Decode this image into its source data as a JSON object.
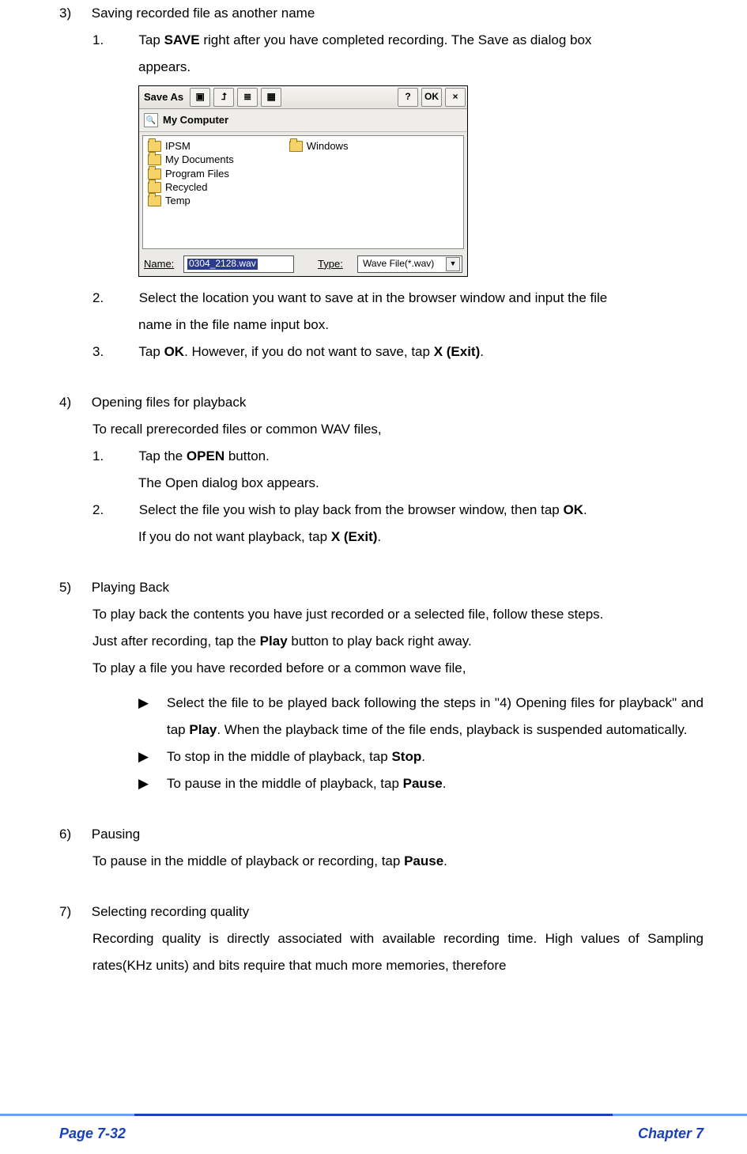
{
  "s3": {
    "num": "3)",
    "title": "Saving recorded file as another name",
    "step1_num": "1.",
    "step1a": "Tap ",
    "step1b": "SAVE",
    "step1c": " right after you have completed recording. The Save as dialog box",
    "step1d": "appears.",
    "step2_num": "2.",
    "step2a": "Select the location you want to save at in the browser window and input the file",
    "step2b": "name in the file name input box.",
    "step3_num": "3.",
    "step3a": "Tap ",
    "step3b": "OK",
    "step3c": ". However, if you do not want to save, tap ",
    "step3d": "X (Exit)",
    "step3e": "."
  },
  "dialog": {
    "title": "Save As",
    "btn_help": "?",
    "btn_ok": "OK",
    "btn_close": "×",
    "loc": "My Computer",
    "foldersA": [
      "IPSM",
      "My Documents",
      "Program Files",
      "Recycled",
      "Temp"
    ],
    "foldersB": [
      "Windows"
    ],
    "name_u": "N",
    "name_rest": "ame:",
    "name_val": "0304_2128.wav",
    "type_u": "T",
    "type_rest": "ype:",
    "type_val": "Wave File(*.wav)"
  },
  "s4": {
    "num": "4)",
    "title": "Opening files for playback",
    "intro": "To recall prerecorded files or common WAV files,",
    "step1_num": "1.",
    "step1a": "Tap the ",
    "step1b": "OPEN",
    "step1c": " button.",
    "step1d": "The Open dialog box appears.",
    "step2_num": "2.",
    "step2a": "Select the file you wish to play back from the browser window, then tap ",
    "step2b": "OK",
    "step2c": ".",
    "step2d": "If you do not want playback, tap ",
    "step2e": "X (Exit)",
    "step2f": "."
  },
  "s5": {
    "num": "5)",
    "title": "Playing Back",
    "p1": "To play back the contents you have just recorded or a selected file, follow these steps.",
    "p2a": "Just after recording, tap the ",
    "p2b": "Play",
    "p2c": " button to play back right away.",
    "p3": "To play a file you have recorded before or a common wave file,",
    "arrow": "▶",
    "b1a": "Select the file to be played back following the steps in \"4) Opening files for playback\" and tap ",
    "b1b": "Play",
    "b1c": ". When the playback time of the file ends, playback is suspended automatically.",
    "b2a": "To stop in the middle of playback, tap ",
    "b2b": "Stop",
    "b2c": ".",
    "b3a": "To pause in the middle of playback, tap ",
    "b3b": "Pause",
    "b3c": "."
  },
  "s6": {
    "num": "6)",
    "title": "Pausing",
    "p1a": "To pause in the middle of playback or recording, tap ",
    "p1b": "Pause",
    "p1c": "."
  },
  "s7": {
    "num": "7)",
    "title": "Selecting recording quality",
    "p1": "Recording quality is directly associated with available recording time. High values of Sampling rates(KHz units) and bits require that much more memories, therefore"
  },
  "footer": {
    "left": "Page 7-32",
    "right": "Chapter 7"
  }
}
